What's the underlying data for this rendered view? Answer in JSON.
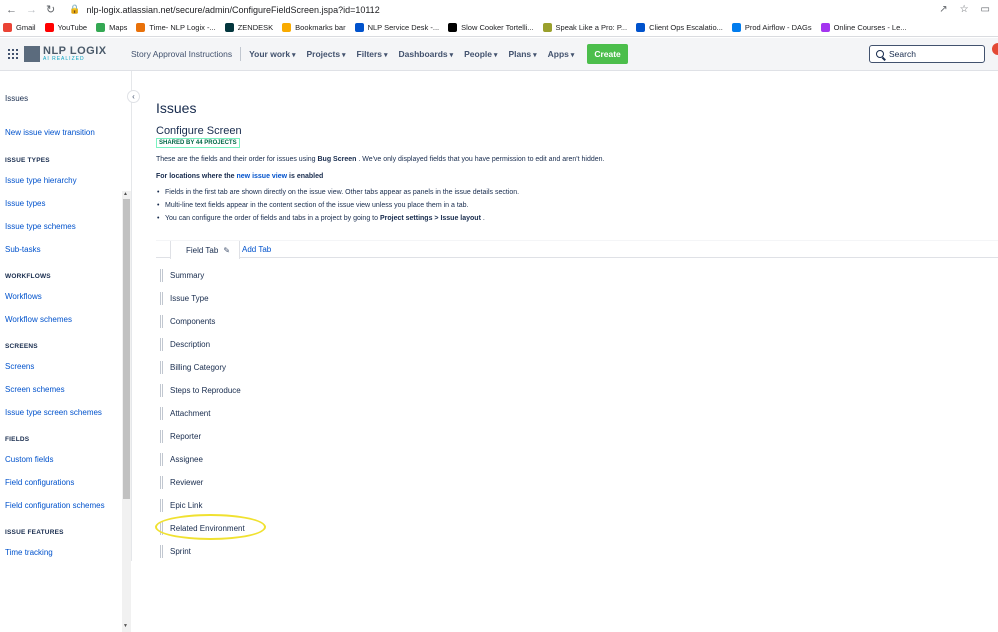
{
  "browser": {
    "url": "nlp-logix.atlassian.net/secure/admin/ConfigureFieldScreen.jspa?id=10112",
    "bookmarks": [
      {
        "label": "Gmail",
        "color": "#ea4335"
      },
      {
        "label": "YouTube",
        "color": "#ff0000"
      },
      {
        "label": "Maps",
        "color": "#34a853"
      },
      {
        "label": "Time- NLP Logix -...",
        "color": "#e8710a"
      },
      {
        "label": "ZENDESK",
        "color": "#03363d"
      },
      {
        "label": "Bookmarks bar",
        "color": "#f9ab00"
      },
      {
        "label": "NLP Service Desk -...",
        "color": "#0052cc"
      },
      {
        "label": "Slow Cooker Tortelli...",
        "color": "#000000"
      },
      {
        "label": "Speak Like a Pro: P...",
        "color": "#9aa02c"
      },
      {
        "label": "Client Ops Escalatio...",
        "color": "#0052cc"
      },
      {
        "label": "Prod Airflow - DAGs",
        "color": "#017cee"
      },
      {
        "label": "Online Courses - Le...",
        "color": "#a435f0"
      }
    ]
  },
  "header": {
    "logo_line1": "NLP LOGIX",
    "logo_line2": "AI REALIZED",
    "story_link": "Story Approval Instructions",
    "menus": [
      "Your work",
      "Projects",
      "Filters",
      "Dashboards",
      "People",
      "Plans",
      "Apps"
    ],
    "create_label": "Create",
    "search_placeholder": "Search"
  },
  "sidebar": {
    "items": [
      {
        "type": "item",
        "label": "Issues",
        "active": true
      },
      {
        "type": "item",
        "label": "New issue view transition"
      },
      {
        "type": "section",
        "label": "ISSUE TYPES"
      },
      {
        "type": "item",
        "label": "Issue type hierarchy"
      },
      {
        "type": "item",
        "label": "Issue types"
      },
      {
        "type": "item",
        "label": "Issue type schemes"
      },
      {
        "type": "item",
        "label": "Sub-tasks"
      },
      {
        "type": "section",
        "label": "WORKFLOWS"
      },
      {
        "type": "item",
        "label": "Workflows"
      },
      {
        "type": "item",
        "label": "Workflow schemes"
      },
      {
        "type": "section",
        "label": "SCREENS"
      },
      {
        "type": "item",
        "label": "Screens"
      },
      {
        "type": "item",
        "label": "Screen schemes"
      },
      {
        "type": "item",
        "label": "Issue type screen schemes"
      },
      {
        "type": "section",
        "label": "FIELDS"
      },
      {
        "type": "item",
        "label": "Custom fields"
      },
      {
        "type": "item",
        "label": "Field configurations"
      },
      {
        "type": "item",
        "label": "Field configuration schemes"
      },
      {
        "type": "section",
        "label": "ISSUE FEATURES"
      },
      {
        "type": "item",
        "label": "Time tracking"
      }
    ]
  },
  "main": {
    "title": "Issues",
    "subtitle": "Configure Screen",
    "shared_badge": "SHARED BY 44 PROJECTS",
    "desc_pre": "These are the fields and their order for issues using ",
    "desc_screen": "Bug Screen",
    "desc_post": " . We've only displayed fields that you have permission to edit and aren't hidden.",
    "loc_pre": "For locations where the ",
    "loc_link": "new issue view",
    "loc_post": " is enabled",
    "bullet1": "Fields in the first tab are shown directly on the issue view. Other tabs appear as panels in the issue details section.",
    "bullet2": "Multi-line text fields appear in the content section of the issue view unless you place them in a tab.",
    "bullet3_pre": "You can configure the order of fields and tabs in a project by going to ",
    "bullet3_bold": "Project settings > Issue layout",
    "bullet3_post": " .",
    "tab_label": "Field Tab",
    "add_tab": "Add Tab",
    "fields": [
      "Summary",
      "Issue Type",
      "Components",
      "Description",
      "Billing Category",
      "Steps to Reproduce",
      "Attachment",
      "Reporter",
      "Assignee",
      "Reviewer",
      "Epic Link",
      "Related Environment",
      "Sprint"
    ]
  }
}
